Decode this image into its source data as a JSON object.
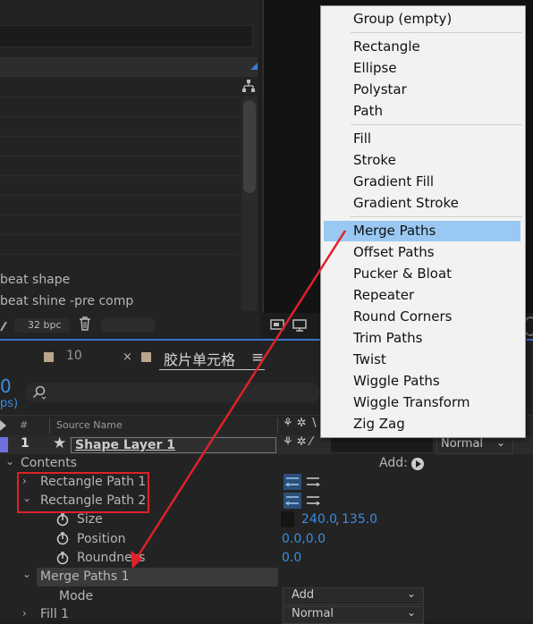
{
  "project": {
    "item1": "beat shape",
    "item2": "beat shine -pre comp",
    "bpc": "32 bpc"
  },
  "timeline": {
    "label_count": "10",
    "close_x": "×",
    "comp_name": "胶片单元格",
    "menu_icon": "≡",
    "frame_digit": "0",
    "fps_fragment": "ps)",
    "col_hash": "#",
    "col_source": "Source Name",
    "layer_index": "1",
    "layer_name": "Shape Layer 1",
    "mode_value": "Normal",
    "contents": "Contents",
    "add_label": "Add:",
    "rect1": "Rectangle Path 1",
    "rect2": "Rectangle Path 2",
    "size": "Size",
    "size_value_a": "240.0",
    "size_sep": ",",
    "size_value_b": "135.0",
    "position": "Position",
    "position_value": "0.0,0.0",
    "roundness": "Roundness",
    "roundness_value": "0.0",
    "merge": "Merge Paths 1",
    "mode_label": "Mode",
    "mode_dropdown": "Add",
    "fill": "Fill 1",
    "fill_dropdown": "Normal"
  },
  "menu": {
    "items": [
      "Group (empty)",
      "Rectangle",
      "Ellipse",
      "Polystar",
      "Path",
      "Fill",
      "Stroke",
      "Gradient Fill",
      "Gradient Stroke",
      "Merge Paths",
      "Offset Paths",
      "Pucker & Bloat",
      "Repeater",
      "Round Corners",
      "Trim Paths",
      "Twist",
      "Wiggle Paths",
      "Wiggle Transform",
      "Zig Zag"
    ],
    "highlighted_index": 9
  },
  "colors": {
    "accent_blue": "#3b8de0",
    "highlight": "#99c9f2",
    "annotation_red": "#e0202a"
  }
}
